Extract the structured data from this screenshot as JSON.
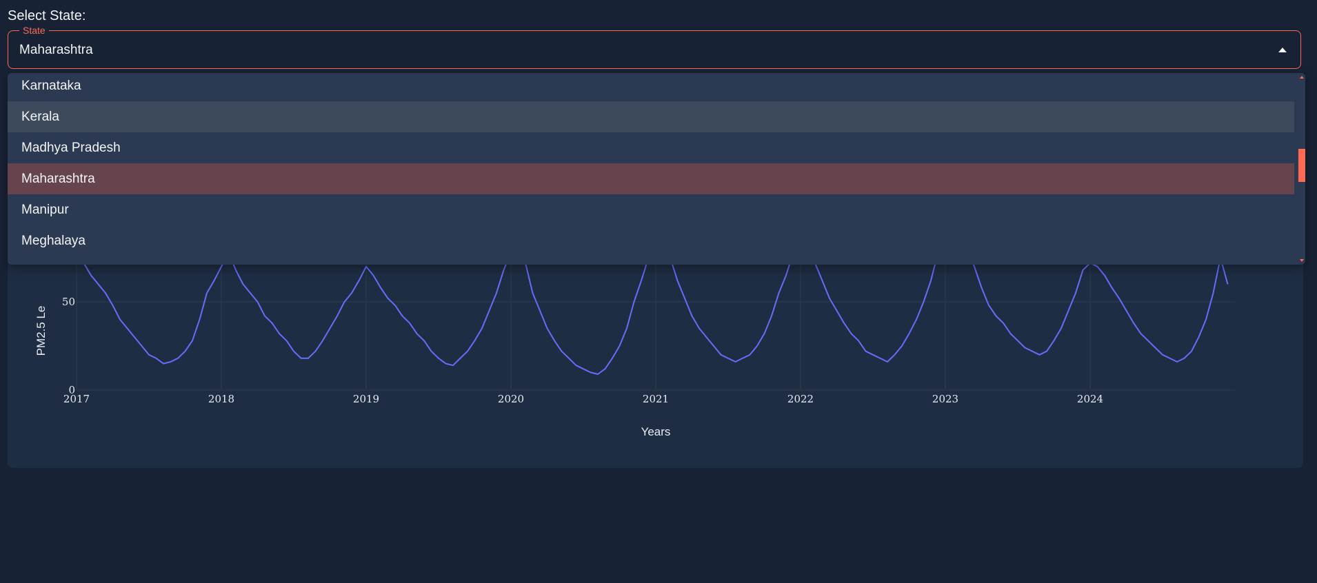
{
  "select": {
    "label": "Select State:",
    "legend": "State",
    "value": "Maharashtra"
  },
  "dropdown": {
    "options": [
      {
        "label": "Karnataka",
        "state": "normal"
      },
      {
        "label": "Kerala",
        "state": "hover"
      },
      {
        "label": "Madhya Pradesh",
        "state": "normal"
      },
      {
        "label": "Maharashtra",
        "state": "selected"
      },
      {
        "label": "Manipur",
        "state": "normal"
      },
      {
        "label": "Meghalaya",
        "state": "normal"
      }
    ]
  },
  "colors": {
    "background": "#172234",
    "card": "#1f2d44",
    "accent": "#ff6a50",
    "line": "#636efa",
    "dropdown": "#2b3a52",
    "hover": "#3c4a5c",
    "selected": "#66444d"
  },
  "chart_data": {
    "type": "line",
    "title": "",
    "xlabel": "Years",
    "ylabel": "PM2.5 Le",
    "x_ticks": [
      "2017",
      "2018",
      "2019",
      "2020",
      "2021",
      "2022",
      "2023",
      "2024"
    ],
    "y_ticks": [
      0,
      50
    ],
    "ylim": [
      0,
      100
    ],
    "xlim": [
      2017,
      2025
    ],
    "grid": true,
    "series": [
      {
        "x": [
          2017.0,
          2017.05,
          2017.1,
          2017.15,
          2017.2,
          2017.25,
          2017.3,
          2017.35,
          2017.4,
          2017.45,
          2017.5,
          2017.55,
          2017.6,
          2017.65,
          2017.7,
          2017.75,
          2017.8,
          2017.85,
          2017.9,
          2017.95,
          2018.0,
          2018.05,
          2018.1,
          2018.15,
          2018.2,
          2018.25,
          2018.3,
          2018.35,
          2018.4,
          2018.45,
          2018.5,
          2018.55,
          2018.6,
          2018.65,
          2018.7,
          2018.75,
          2018.8,
          2018.85,
          2018.9,
          2018.95,
          2019.0,
          2019.05,
          2019.1,
          2019.15,
          2019.2,
          2019.25,
          2019.3,
          2019.35,
          2019.4,
          2019.45,
          2019.5,
          2019.55,
          2019.6,
          2019.65,
          2019.7,
          2019.75,
          2019.8,
          2019.85,
          2019.9,
          2019.95,
          2020.0,
          2020.05,
          2020.1,
          2020.15,
          2020.2,
          2020.25,
          2020.3,
          2020.35,
          2020.4,
          2020.45,
          2020.5,
          2020.55,
          2020.6,
          2020.65,
          2020.7,
          2020.75,
          2020.8,
          2020.85,
          2020.9,
          2020.95,
          2021.0,
          2021.05,
          2021.1,
          2021.15,
          2021.2,
          2021.25,
          2021.3,
          2021.35,
          2021.4,
          2021.45,
          2021.5,
          2021.55,
          2021.6,
          2021.65,
          2021.7,
          2021.75,
          2021.8,
          2021.85,
          2021.9,
          2021.95,
          2022.0,
          2022.05,
          2022.1,
          2022.15,
          2022.2,
          2022.25,
          2022.3,
          2022.35,
          2022.4,
          2022.45,
          2022.5,
          2022.55,
          2022.6,
          2022.65,
          2022.7,
          2022.75,
          2022.8,
          2022.85,
          2022.9,
          2022.95,
          2023.0,
          2023.05,
          2023.1,
          2023.15,
          2023.2,
          2023.25,
          2023.3,
          2023.35,
          2023.4,
          2023.45,
          2023.5,
          2023.55,
          2023.6,
          2023.65,
          2023.7,
          2023.75,
          2023.8,
          2023.85,
          2023.9,
          2023.95,
          2024.0,
          2024.05,
          2024.1,
          2024.15,
          2024.2,
          2024.25,
          2024.3,
          2024.35,
          2024.4,
          2024.45,
          2024.5,
          2024.55,
          2024.6,
          2024.65,
          2024.7,
          2024.75,
          2024.8,
          2024.85,
          2024.9,
          2024.95
        ],
        "values": [
          75,
          72,
          65,
          60,
          55,
          48,
          40,
          35,
          30,
          25,
          20,
          18,
          15,
          16,
          18,
          22,
          28,
          40,
          55,
          62,
          70,
          78,
          68,
          60,
          55,
          50,
          42,
          38,
          32,
          28,
          22,
          18,
          18,
          22,
          28,
          35,
          42,
          50,
          55,
          62,
          70,
          65,
          58,
          52,
          48,
          42,
          38,
          32,
          28,
          22,
          18,
          15,
          14,
          18,
          22,
          28,
          35,
          45,
          55,
          68,
          78,
          85,
          72,
          55,
          45,
          35,
          28,
          22,
          18,
          14,
          12,
          10,
          9,
          12,
          18,
          25,
          35,
          50,
          62,
          75,
          82,
          88,
          75,
          62,
          52,
          42,
          35,
          30,
          25,
          20,
          18,
          16,
          18,
          20,
          25,
          32,
          42,
          55,
          65,
          78,
          85,
          80,
          72,
          62,
          52,
          45,
          38,
          32,
          28,
          22,
          20,
          18,
          16,
          20,
          25,
          32,
          40,
          50,
          62,
          78,
          88,
          95,
          90,
          82,
          70,
          58,
          48,
          42,
          38,
          32,
          28,
          24,
          22,
          20,
          22,
          28,
          35,
          45,
          55,
          68,
          72,
          70,
          65,
          58,
          52,
          45,
          38,
          32,
          28,
          24,
          20,
          18,
          16,
          18,
          22,
          30,
          40,
          55,
          75,
          60
        ]
      }
    ]
  }
}
